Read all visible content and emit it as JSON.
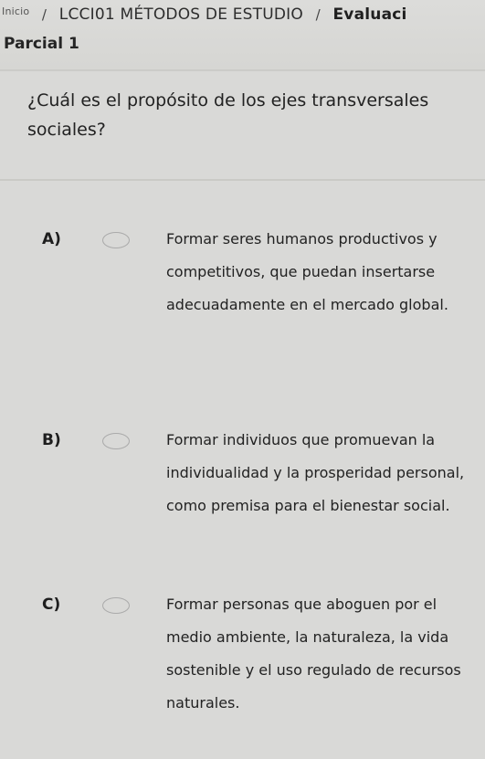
{
  "breadcrumb": {
    "home": "Inicio",
    "course": "LCCI01 MÉTODOS DE ESTUDIO",
    "section": "Evaluaci"
  },
  "page_title": "Parcial 1",
  "question": "¿Cuál es el propósito de los ejes transversales sociales?",
  "options": [
    {
      "letter": "A)",
      "text": "Formar seres humanos productivos y competitivos, que puedan insertarse adecuadamente en el mercado global."
    },
    {
      "letter": "B)",
      "text": "Formar individuos que promuevan la individualidad y la prosperidad personal, como premisa para el bienestar social."
    },
    {
      "letter": "C)",
      "text": "Formar personas que aboguen por el medio ambiente, la naturaleza, la vida sostenible y el uso regulado de recursos naturales."
    }
  ]
}
